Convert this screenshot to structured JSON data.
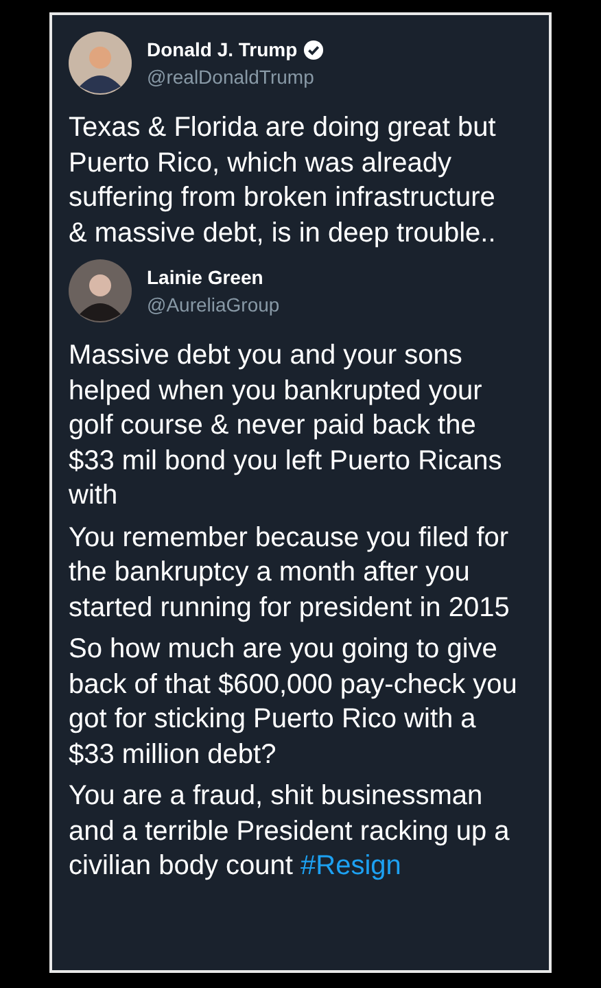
{
  "tweets": [
    {
      "author": {
        "name": "Donald J. Trump",
        "handle": "@realDonaldTrump",
        "verified": true
      },
      "paragraphs": [
        {
          "text": "Texas & Florida are doing great but Puerto Rico, which was already suffering from broken infrastructure & massive debt, is in deep trouble.."
        }
      ]
    },
    {
      "author": {
        "name": "Lainie Green",
        "handle": "@AureliaGroup",
        "verified": false
      },
      "paragraphs": [
        {
          "text": "Massive debt you and your sons helped when you bankrupted your golf course & never paid back the $33 mil bond you left Puerto Ricans with"
        },
        {
          "text": "You remember because you filed for the bankruptcy a month after you started running for president in 2015"
        },
        {
          "text": "So how much are you going to give back of that $600,000 pay-check you got for sticking Puerto Rico with a $33 million debt?"
        },
        {
          "text": "You are a fraud, shit businessman and a terrible President racking up a civilian body count",
          "hashtag": "#Resign"
        }
      ]
    }
  ]
}
